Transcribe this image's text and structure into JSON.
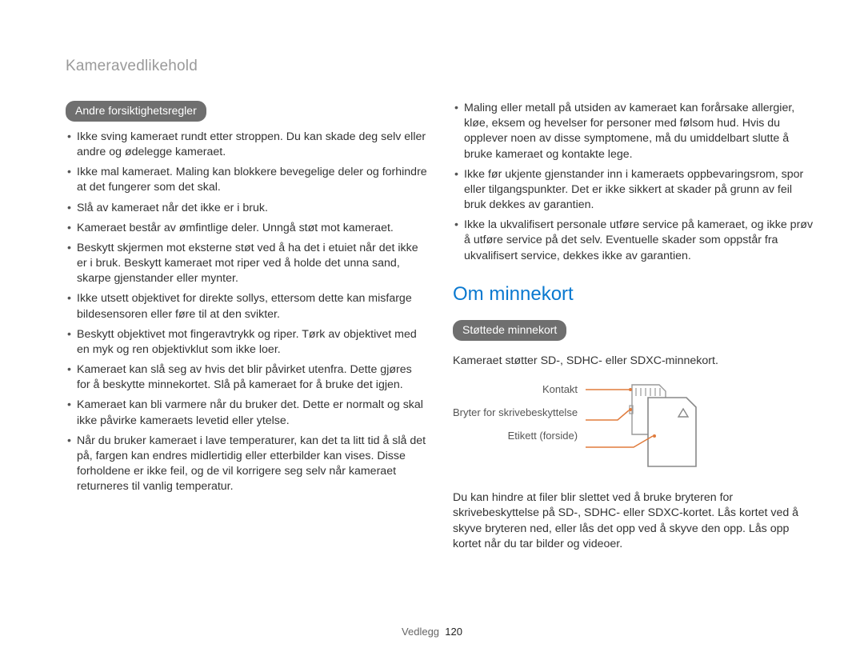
{
  "running_head": "Kameravedlikehold",
  "left": {
    "heading_pill": "Andre forsiktighetsregler",
    "bullets": [
      "Ikke sving kameraet rundt etter stroppen. Du kan skade deg selv eller andre og ødelegge kameraet.",
      "Ikke mal kameraet. Maling kan blokkere bevegelige deler og forhindre at det fungerer som det skal.",
      "Slå av kameraet når det ikke er i bruk.",
      "Kameraet består av ømfintlige deler. Unngå støt mot kameraet.",
      "Beskytt skjermen mot eksterne støt ved å ha det i etuiet når det ikke er i bruk. Beskytt kameraet mot riper ved å holde det unna sand, skarpe gjenstander eller mynter.",
      "Ikke utsett objektivet for direkte sollys, ettersom dette kan misfarge bildesensoren eller føre til at den svikter.",
      "Beskytt objektivet mot fingeravtrykk og riper. Tørk av objektivet med en myk og ren objektivklut som ikke loer.",
      "Kameraet kan slå seg av hvis det blir påvirket utenfra. Dette gjøres for å beskytte minnekortet. Slå på kameraet for å bruke det igjen.",
      "Kameraet kan bli varmere når du bruker det. Dette er normalt og skal ikke påvirke kameraets levetid eller ytelse.",
      "Når du bruker kameraet i lave temperaturer, kan det ta litt tid å slå det på, fargen kan endres midlertidig eller etterbilder kan vises. Disse forholdene er ikke feil, og de vil korrigere seg selv når kameraet returneres til vanlig temperatur."
    ]
  },
  "right_top_bullets": [
    "Maling eller metall på utsiden av kameraet kan forårsake allergier, kløe, eksem og hevelser for personer med følsom hud. Hvis du opplever noen av disse symptomene, må du umiddelbart slutte å bruke kameraet og kontakte lege.",
    "Ikke før ukjente gjenstander inn i kameraets oppbevaringsrom, spor eller tilgangspunkter. Det er ikke sikkert at skader på grunn av feil bruk dekkes av garantien.",
    "Ikke la ukvalifisert personale utføre service på kameraet, og ikke prøv å utføre service på det selv. Eventuelle skader som oppstår fra ukvalifisert service, dekkes ikke av garantien."
  ],
  "right": {
    "section_title": "Om minnekort",
    "sub_pill": "Støttede minnekort",
    "intro": "Kameraet støtter SD-, SDHC- eller SDXC-minnekort.",
    "diagram_labels": {
      "contact": "Kontakt",
      "write_protect": "Bryter for skrivebeskyttelse",
      "label_front": "Etikett (forside)"
    },
    "after": "Du kan hindre at filer blir slettet ved å bruke bryteren for skrivebeskyttelse på SD-, SDHC- eller SDXC-kortet. Lås kortet ved å skyve bryteren ned, eller lås det opp ved å skyve den opp. Lås opp kortet når du tar bilder og videoer."
  },
  "footer": {
    "section": "Vedlegg",
    "page": "120"
  }
}
